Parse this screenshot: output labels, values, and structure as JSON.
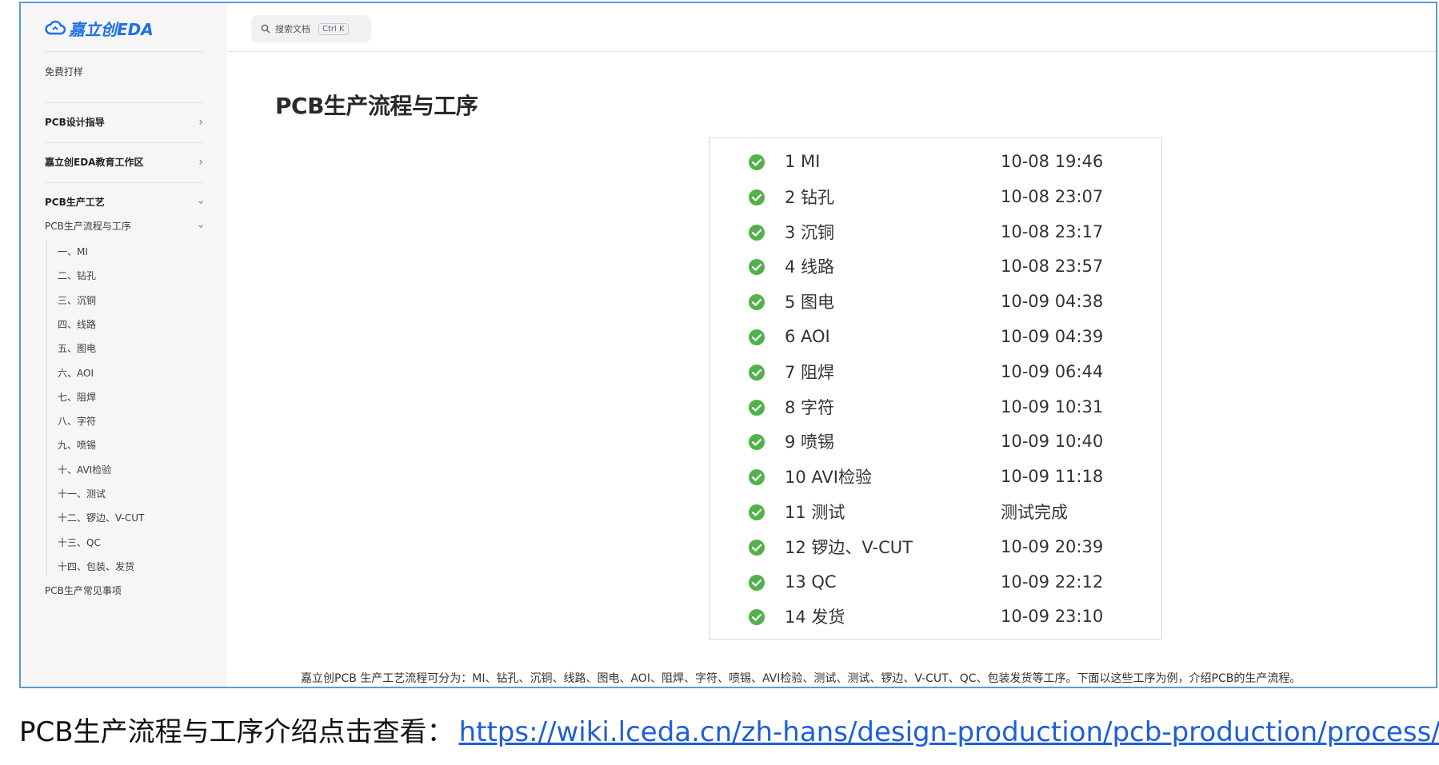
{
  "sidebar": {
    "logo_text": "嘉立创EDA",
    "free_proto": "免费打样",
    "sections": [
      "PCB设计指导",
      "嘉立创EDA教育工作区",
      "PCB生产工艺"
    ],
    "subsection": "PCB生产流程与工序",
    "tree_items": [
      "一、MI",
      "二、钻孔",
      "三、沉铜",
      "四、线路",
      "五、图电",
      "六、AOI",
      "七、阻焊",
      "八、字符",
      "九、喷锡",
      "十、AVI检验",
      "十一、测试",
      "十二、锣边、V-CUT",
      "十三、QC",
      "十四、包装、发货"
    ],
    "last_link": "PCB生产常见事项"
  },
  "search": {
    "placeholder": "搜索文档",
    "shortcut": "Ctrl K"
  },
  "page_title": "PCB生产流程与工序",
  "steps": [
    {
      "name": "1 MI",
      "time": "10-08 19:46"
    },
    {
      "name": "2 钻孔",
      "time": "10-08 23:07"
    },
    {
      "name": "3 沉铜",
      "time": "10-08 23:17"
    },
    {
      "name": "4 线路",
      "time": "10-08 23:57"
    },
    {
      "name": "5 图电",
      "time": "10-09 04:38"
    },
    {
      "name": "6 AOI",
      "time": "10-09 04:39"
    },
    {
      "name": "7 阻焊",
      "time": "10-09 06:44"
    },
    {
      "name": "8 字符",
      "time": "10-09 10:31"
    },
    {
      "name": "9 喷锡",
      "time": "10-09 10:40"
    },
    {
      "name": "10 AVI检验",
      "time": "10-09 11:18"
    },
    {
      "name": "11 测试",
      "time": "测试完成"
    },
    {
      "name": "12 锣边、V-CUT",
      "time": "10-09 20:39"
    },
    {
      "name": "13 QC",
      "time": "10-09 22:12"
    },
    {
      "name": "14 发货",
      "time": "10-09 23:10"
    }
  ],
  "caption": "嘉立创PCB 生产工艺流程可分为：MI、钻孔、沉铜、线路、图电、AOI、阻焊、字符、喷锡、AVI检验、测试、测试、锣边、V-CUT、QC、包装发货等工序。下面以这些工序为例，介绍PCB的生产流程。",
  "bottom": {
    "label": "PCB生产流程与工序介绍点击查看：",
    "url": "https://wiki.lceda.cn/zh-hans/design-production/pcb-production/process/"
  },
  "colors": {
    "check_green": "#52b14b",
    "link_blue": "#1f5fd6",
    "frame_blue": "#5b9bd5",
    "logo_blue": "#1e6fe8"
  }
}
